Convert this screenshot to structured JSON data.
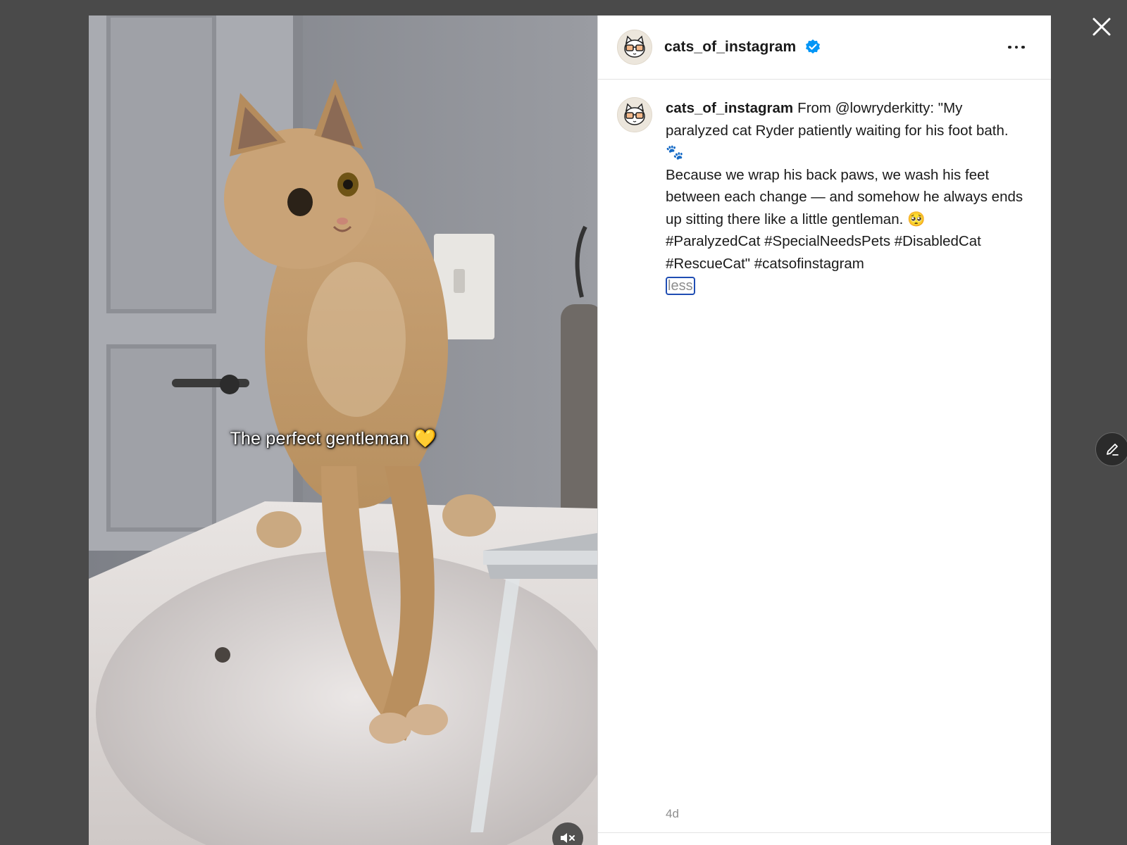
{
  "close_icon": "close-icon",
  "media": {
    "overlay_caption": "The perfect gentleman 💛",
    "mute_icon": "speaker-muted-icon"
  },
  "header": {
    "username": "cats_of_instagram",
    "verified_icon": "verified-badge-icon",
    "more_icon": "more-options-icon"
  },
  "post": {
    "username": "cats_of_instagram",
    "caption_lines": [
      "From @lowryderkitty: \"My paralyzed cat Ryder patiently waiting for his foot bath. 🐾",
      "Because we wrap his back paws, we wash his feet between each change — and somehow he always ends up sitting there like a little gentleman. 🥺",
      "#ParalyzedCat #SpecialNeedsPets #DisabledCat #RescueCat\" #catsofinstagram"
    ],
    "less_label": "less",
    "timestamp": "4d"
  },
  "edit_icon": "pencil-edit-icon",
  "colors": {
    "backdrop": "#4a4a4a",
    "verified": "#0095f6",
    "focus_ring": "#1f4db3",
    "muted_text": "#8e8e8e"
  }
}
